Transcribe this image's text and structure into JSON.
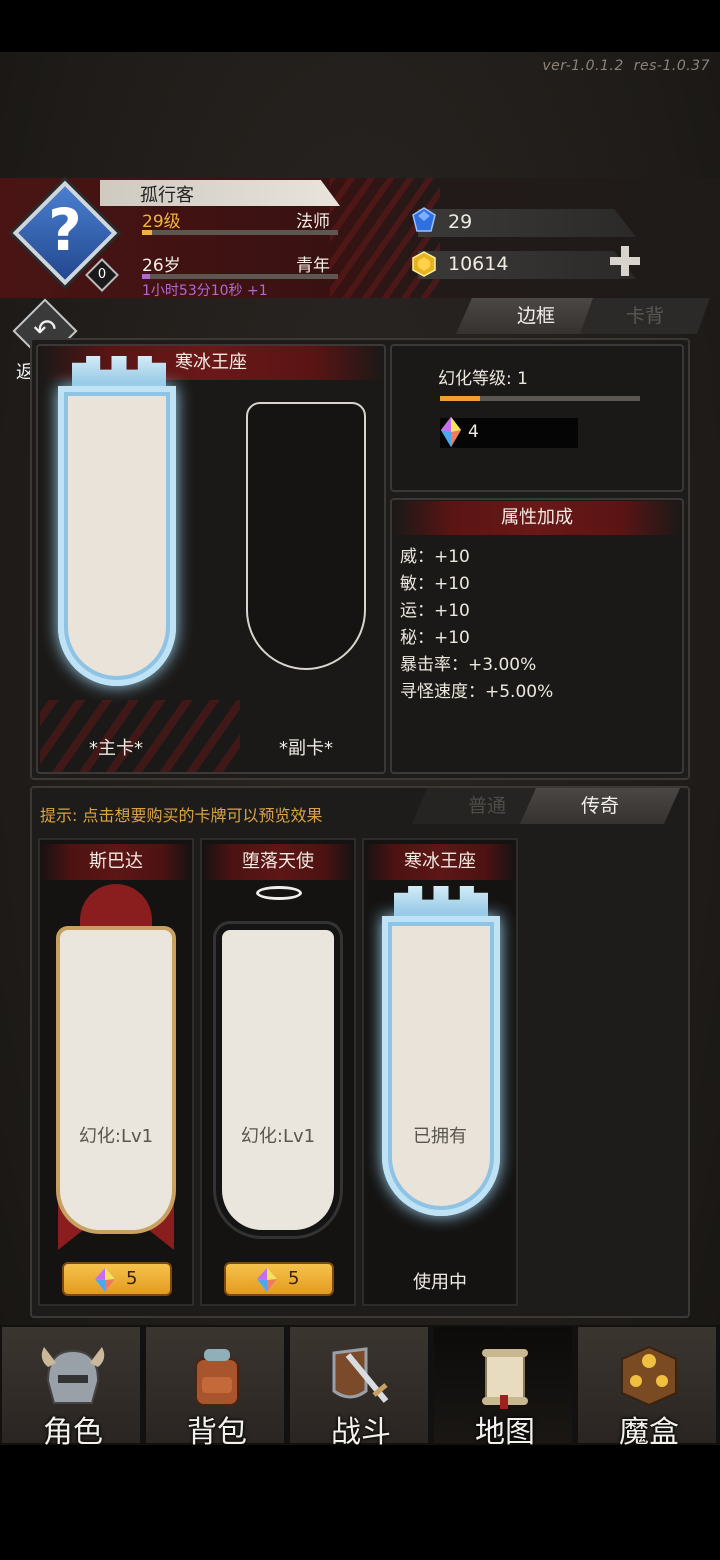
{
  "version": {
    "ver": "ver-1.0.1.2",
    "res": "res-1.0.37"
  },
  "player": {
    "name": "孤行客",
    "level": "29级",
    "class": "法师",
    "age": "26岁",
    "stage": "青年",
    "timer": "1小时53分10秒 +1",
    "avatar_badge": "0",
    "level_progress": 0.05,
    "age_progress": 0.04
  },
  "resources": {
    "gems": "29",
    "gold": "10614"
  },
  "back_button": {
    "label": "返 回"
  },
  "tabs": [
    {
      "label": "边框",
      "active": true
    },
    {
      "label": "卡背",
      "active": false
    }
  ],
  "preview": {
    "title": "寒冰王座",
    "main_label": "*主卡*",
    "sub_label": "*副卡*"
  },
  "illusion": {
    "level_label": "幻化等级: 1",
    "level_progress": 0.2,
    "crystal_count": "4"
  },
  "attributes": {
    "title": "属性加成",
    "lines": [
      "威：+10",
      "敏：+10",
      "运：+10",
      "秘：+10",
      "暴击率：+3.00%",
      "寻怪速度：+5.00%"
    ]
  },
  "shop": {
    "hint": "提示: 点击想要购买的卡牌可以预览效果",
    "tabs": [
      {
        "label": "普通",
        "active": false
      },
      {
        "label": "传奇",
        "active": true
      }
    ],
    "cards": [
      {
        "title": "斯巴达",
        "caption": "幻化:Lv1",
        "price": "5",
        "status": ""
      },
      {
        "title": "堕落天使",
        "caption": "幻化:Lv1",
        "price": "5",
        "status": ""
      },
      {
        "title": "寒冰王座",
        "caption": "已拥有",
        "price": "",
        "status": "使用中"
      }
    ]
  },
  "nav": [
    {
      "label": "角色",
      "icon": "helmet-icon",
      "active": false
    },
    {
      "label": "背包",
      "icon": "backpack-icon",
      "active": false
    },
    {
      "label": "战斗",
      "icon": "sword-shield-icon",
      "active": false
    },
    {
      "label": "地图",
      "icon": "scroll-map-icon",
      "active": true
    },
    {
      "label": "魔盒",
      "icon": "magic-box-icon",
      "active": false
    }
  ],
  "colors": {
    "accent_red": "#5a1414",
    "gold_button": "#f0b43a",
    "hint_text": "#d9a446",
    "timer_purple": "#b06ad0"
  }
}
